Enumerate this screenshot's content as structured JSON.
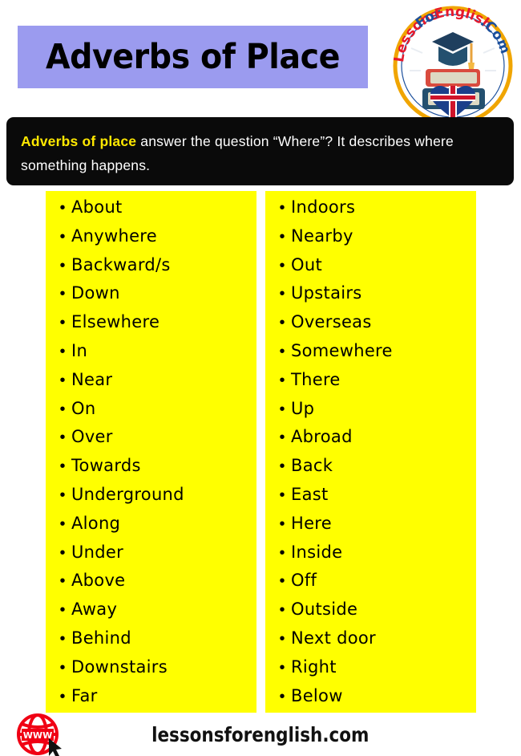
{
  "header": {
    "title": "Adverbs of Place",
    "banner_color": "#9b9bef",
    "logo": {
      "name": "lessons-for-english-logo",
      "text_part_1": "Lessons",
      "text_part_2": "For",
      "text_part_3": "English",
      "text_part_4": ".Com",
      "ring_color": "#f0a500",
      "red_color": "#e8192c",
      "blue_color": "#1b4f9c"
    }
  },
  "description": {
    "lead": "Adverbs of place",
    "rest": " answer the question “Where”? It describes where something happens.",
    "lead_color": "#ffe800",
    "background": "#0a0a0a"
  },
  "columns": {
    "background": "#ffff00",
    "bullet": "•",
    "left": {
      "items": [
        "About",
        "Anywhere",
        "Backward/s",
        "Down",
        "Elsewhere",
        "In",
        "Near",
        "On",
        "Over",
        "Towards",
        "Underground",
        "Along",
        "Under",
        "Above",
        "Away",
        "Behind",
        "Downstairs",
        "Far"
      ]
    },
    "right": {
      "items": [
        "Indoors",
        "Nearby",
        "Out",
        "Upstairs",
        "Overseas",
        "Somewhere",
        "There",
        "Up",
        "Abroad",
        "Back",
        "East",
        "Here",
        "Inside",
        "Off",
        "Outside",
        "Next door",
        "Right",
        "Below"
      ]
    }
  },
  "footer": {
    "site": "lessonsforenglish.com",
    "globe_label": "WWW",
    "globe_color": "#f00014"
  }
}
